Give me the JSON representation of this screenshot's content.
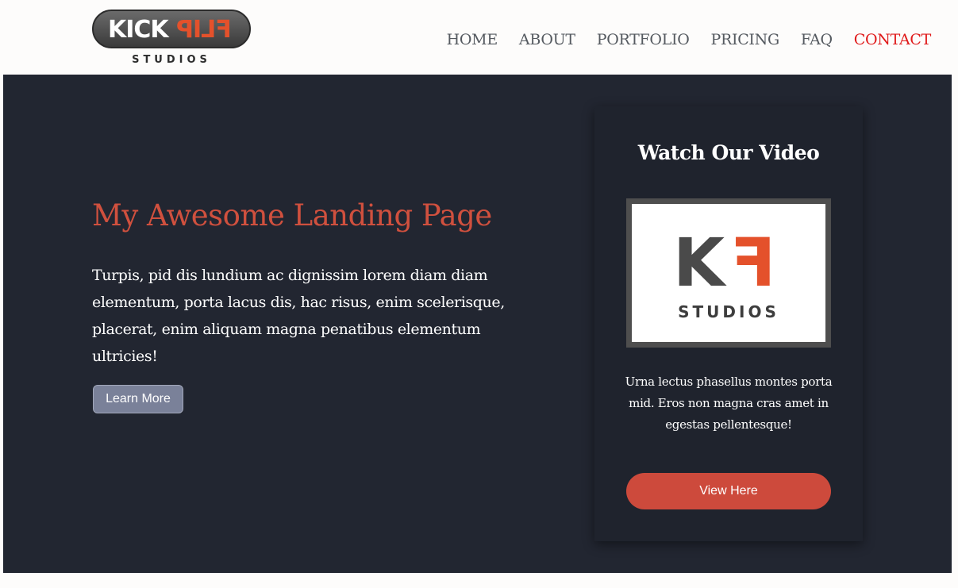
{
  "brand": {
    "logo_word_1": "KICK",
    "logo_word_2": "FLIP",
    "logo_sub": "STUDIOS"
  },
  "nav": {
    "items": [
      "HOME",
      "ABOUT",
      "PORTFOLIO",
      "PRICING",
      "FAQ",
      "CONTACT"
    ],
    "active": "CONTACT"
  },
  "hero": {
    "title": "My Awesome Landing Page",
    "text": "Turpis, pid dis lundium ac dignissim lorem diam diam elementum, porta lacus dis, hac risus, enim scelerisque, placerat, enim aliquam magna penatibus elementum ultricies!",
    "button_label": "Learn More"
  },
  "video_card": {
    "title": "Watch Our Video",
    "thumbnail": {
      "letter_1": "K",
      "letter_2": "F",
      "caption": "STUDIOS"
    },
    "text": "Urna lectus phasellus montes porta mid. Eros non magna cras amet in egestas pellentesque!",
    "button_label": "View Here"
  },
  "colors": {
    "accent": "#d0503e",
    "nav_active": "#e01b1b",
    "hero_bg": "#222631",
    "learn_button": "#7a8199",
    "view_button": "#cd4a3c"
  }
}
